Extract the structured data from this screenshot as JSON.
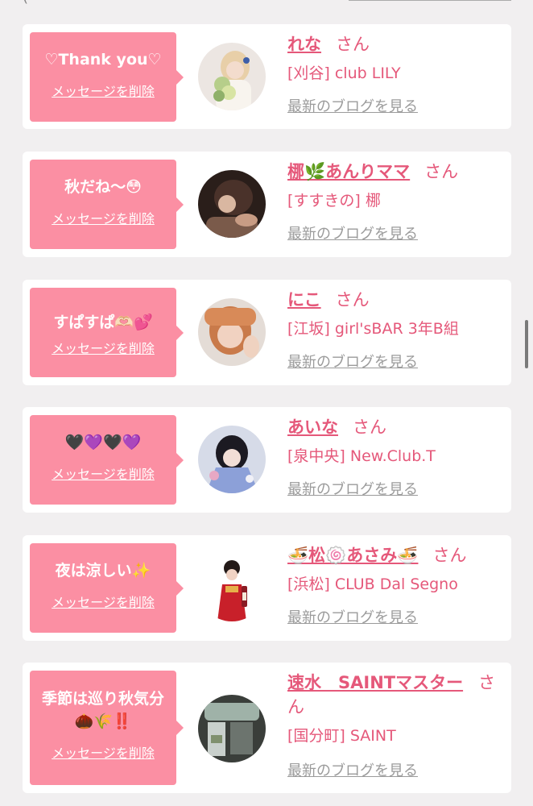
{
  "header_fragment": "(",
  "delete_label": "メッセージを削除",
  "blog_label": "最新のブログを見る",
  "cards": [
    {
      "message": "♡Thank you♡",
      "name": "れな",
      "honorific": "さん",
      "shop": "[刈谷] club LILY"
    },
    {
      "message": "秋だね～😳",
      "name": "梛🌿あんりママ",
      "honorific": "さん",
      "shop": "[すすきの] 梛"
    },
    {
      "message": "すぱすぱ🫶🏻💕",
      "name": "にこ",
      "honorific": "さん",
      "shop": "[江坂] girl'sBAR 3年B組"
    },
    {
      "message": "🖤💜🖤💜",
      "name": "あいな",
      "honorific": "さん",
      "shop": "[泉中央] New.Club.T"
    },
    {
      "message": "夜は涼しい✨",
      "name": "🍜松🍥あさみ🍜",
      "honorific": "さん",
      "shop": "[浜松] CLUB Dal Segno"
    },
    {
      "message": "季節は巡り秋気分",
      "message_line2": "🌰🌾‼️",
      "name": "速水　SAINTマスター",
      "honorific": "さ",
      "honorific_line2": "ん",
      "shop": "[国分町] SAINT"
    }
  ],
  "colors": {
    "page_background": "#f1eff0",
    "bubble": "#fb8fa3",
    "accent_text": "#e5587a",
    "link_gray": "#9b9b9b"
  }
}
